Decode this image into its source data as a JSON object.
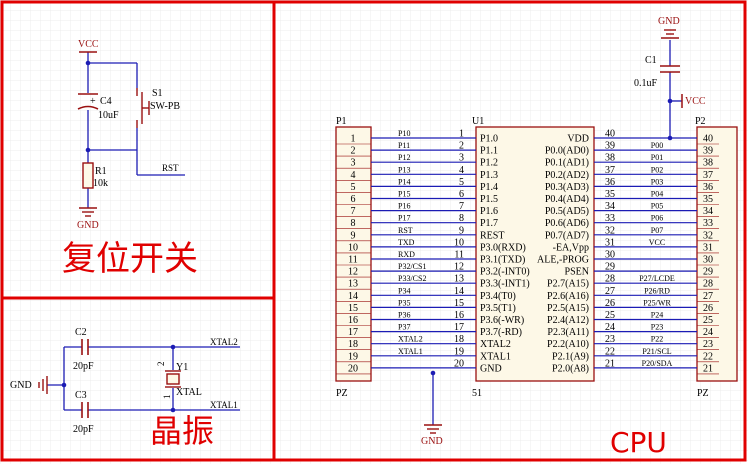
{
  "panels": {
    "reset_title": "复位开关",
    "crystal_title": "晶振",
    "cpu_title": "CPU"
  },
  "reset": {
    "vcc": "VCC",
    "c4_ref": "C4",
    "c4_plus": "+",
    "c4_value": "10uF",
    "s1_ref": "S1",
    "s1_value": "SW-PB",
    "r1_ref": "R1",
    "r1_value": "10k",
    "gnd": "GND",
    "rst_net": "RST"
  },
  "crystal": {
    "c2_ref": "C2",
    "c2_value": "20pF",
    "c3_ref": "C3",
    "c3_value": "20pF",
    "gnd": "GND",
    "y1_ref": "Y1",
    "y1_value": "XTAL",
    "pin2": "2",
    "pin1": "1",
    "xtal2_net": "XTAL2",
    "xtal1_net": "XTAL1"
  },
  "power": {
    "gnd_top": "GND",
    "c1_ref": "C1",
    "c1_value": "0.1uF",
    "vcc": "VCC",
    "gnd_bottom": "GND"
  },
  "p1": {
    "ref": "P1",
    "foot": "PZ",
    "pins": [
      "1",
      "2",
      "3",
      "4",
      "5",
      "6",
      "7",
      "8",
      "9",
      "10",
      "11",
      "12",
      "13",
      "14",
      "15",
      "16",
      "17",
      "18",
      "19",
      "20"
    ],
    "nets": [
      "P10",
      "P11",
      "P12",
      "P13",
      "P14",
      "P15",
      "P16",
      "P17",
      "RST",
      "TXD",
      "RXD",
      "P32/CS1",
      "P33/CS2",
      "P34",
      "P35",
      "P36",
      "P37",
      "XTAL2",
      "XTAL1",
      ""
    ]
  },
  "u1": {
    "ref": "U1",
    "foot": "51",
    "left_pins": [
      "1",
      "2",
      "3",
      "4",
      "5",
      "6",
      "7",
      "8",
      "9",
      "10",
      "11",
      "12",
      "13",
      "14",
      "15",
      "16",
      "17",
      "18",
      "19",
      "20"
    ],
    "left_names": [
      "P1.0",
      "P1.1",
      "P1.2",
      "P1.3",
      "P1.4",
      "P1.5",
      "P1.6",
      "P1.7",
      "REST",
      "P3.0(RXD)",
      "P3.1(TXD)",
      "P3.2(-INT0)",
      "P3.3(-INT1)",
      "P3.4(T0)",
      "P3.5(T1)",
      "P3.6(-WR)",
      "P3.7(-RD)",
      "XTAL2",
      "XTAL1",
      "GND"
    ],
    "right_pins": [
      "40",
      "39",
      "38",
      "37",
      "36",
      "35",
      "34",
      "33",
      "32",
      "31",
      "30",
      "29",
      "28",
      "27",
      "26",
      "25",
      "24",
      "23",
      "22",
      "21"
    ],
    "right_names": [
      "VDD",
      "P0.0(AD0)",
      "P0.1(AD1)",
      "P0.2(AD2)",
      "P0.3(AD3)",
      "P0.4(AD4)",
      "P0.5(AD5)",
      "P0.6(AD6)",
      "P0.7(AD7)",
      "-EA,Vpp",
      "ALE,-PROG",
      "PSEN",
      "P2.7(A15)",
      "P2.6(A16)",
      "P2.5(A15)",
      "P2.4(A12)",
      "P2.3(A11)",
      "P2.2(A10)",
      "P2.1(A9)",
      "P2.0(A8)"
    ],
    "right_nets": [
      "",
      "P00",
      "P01",
      "P02",
      "P03",
      "P04",
      "P05",
      "P06",
      "P07",
      "VCC",
      "",
      "",
      "P27/LCDE",
      "P26/RD",
      "P25/WR",
      "P24",
      "P23",
      "P22",
      "P21/SCL",
      "P20/SDA"
    ]
  },
  "p2": {
    "ref": "P2",
    "foot": "PZ",
    "pins": [
      "40",
      "39",
      "38",
      "37",
      "36",
      "35",
      "34",
      "33",
      "32",
      "31",
      "30",
      "29",
      "28",
      "27",
      "26",
      "25",
      "24",
      "23",
      "22",
      "21"
    ]
  },
  "colors": {
    "frame": "#e00000",
    "wire": "#1c1cb4",
    "part": "#9a1010",
    "text": "#000000",
    "body_fill": "#fdf8e7",
    "grid": "#ececec"
  }
}
